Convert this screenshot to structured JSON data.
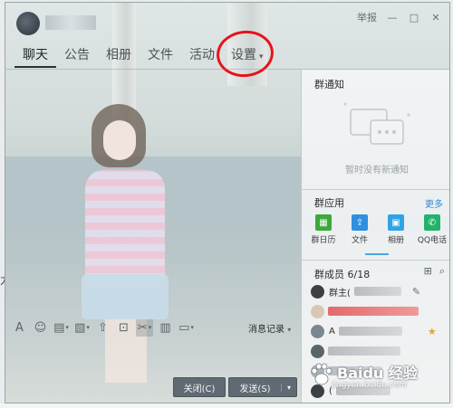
{
  "window": {
    "title": "",
    "controls": [
      "举报",
      "—",
      "□",
      "✕"
    ]
  },
  "tabs": [
    {
      "label": "聊天",
      "active": true
    },
    {
      "label": "公告"
    },
    {
      "label": "相册"
    },
    {
      "label": "文件"
    },
    {
      "label": "活动"
    },
    {
      "label": "设置",
      "dropdown": true
    }
  ],
  "notice": {
    "title": "群通知",
    "empty_text": "暂时没有新通知"
  },
  "apps": {
    "title": "群应用",
    "more": "更多",
    "items": [
      {
        "label": "群日历",
        "icon": "calendar-icon",
        "color": "#3aa93a"
      },
      {
        "label": "文件",
        "icon": "file-upload-icon",
        "color": "#2f8fe0"
      },
      {
        "label": "相册",
        "icon": "photo-icon",
        "color": "#2fa3e6"
      },
      {
        "label": "QQ电话",
        "icon": "phone-icon",
        "color": "#22b36b"
      }
    ]
  },
  "members": {
    "title": "群成员 6/18",
    "rows": [
      {
        "name": "群主(",
        "badge": "edit-icon"
      },
      {
        "name": "",
        "badge": ""
      },
      {
        "name": "A",
        "badge": "star-icon"
      },
      {
        "name": "",
        "badge": ""
      },
      {
        "name": "",
        "badge": ""
      },
      {
        "name": "(",
        "badge": ""
      }
    ]
  },
  "toolbar": {
    "history_label": "消息记录"
  },
  "buttons": {
    "close": "关闭(C)",
    "send": "发送(S)"
  },
  "watermark": {
    "brand": "Baidu 经验",
    "url": "jingyan.baidu.com"
  },
  "colors": {
    "annotation_circle": "#e8121a",
    "link": "#2e8ad8"
  }
}
